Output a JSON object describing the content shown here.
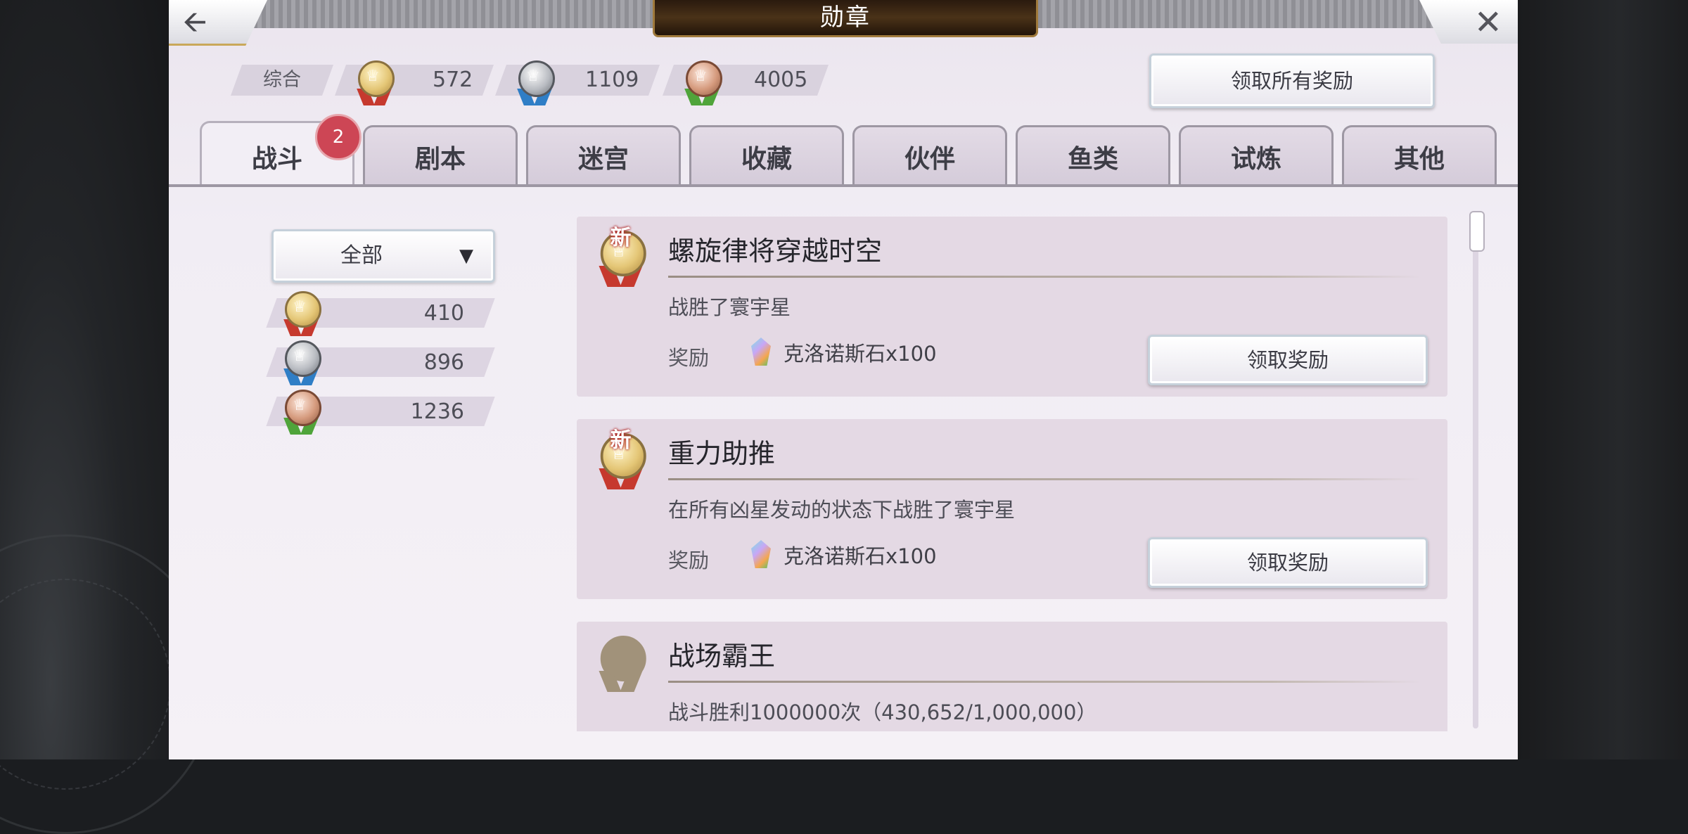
{
  "window": {
    "title": "勋章"
  },
  "totals": {
    "label": "综合",
    "gold": "572",
    "silver": "1109",
    "bronze": "4005"
  },
  "claim_all_label": "领取所有奖励",
  "tabs": [
    "战斗",
    "剧本",
    "迷宫",
    "收藏",
    "伙伴",
    "鱼类",
    "试炼",
    "其他"
  ],
  "active_tab": "战斗",
  "badge_count": "2",
  "filter": {
    "selected": "全部"
  },
  "category_counts": {
    "gold": "410",
    "silver": "896",
    "bronze": "1236"
  },
  "new_tag": "新",
  "reward_label": "奖励",
  "claim_label": "领取奖励",
  "achievements": [
    {
      "name": "螺旋律将穿越时空",
      "desc": "战胜了寰宇星",
      "reward": "克洛诺斯石x100",
      "medal": "gold",
      "is_new": true
    },
    {
      "name": "重力助推",
      "desc": "在所有凶星发动的状态下战胜了寰宇星",
      "reward": "克洛诺斯石x100",
      "medal": "gold",
      "is_new": true
    },
    {
      "name": "战场霸王",
      "desc": "战斗胜利1000000次（430,652/1,000,000）",
      "medal": "locked",
      "is_new": false
    }
  ],
  "colors": {
    "gold_ribbon": "#c6392e",
    "silver_ribbon": "#2f7ec6",
    "bronze_ribbon": "#4fa43a",
    "badge": "#cd4655"
  },
  "icons": {
    "back": "arrow-left-icon",
    "close": "close-icon",
    "dropdown": "caret-down-icon",
    "reward": "chronos-stone-icon"
  }
}
